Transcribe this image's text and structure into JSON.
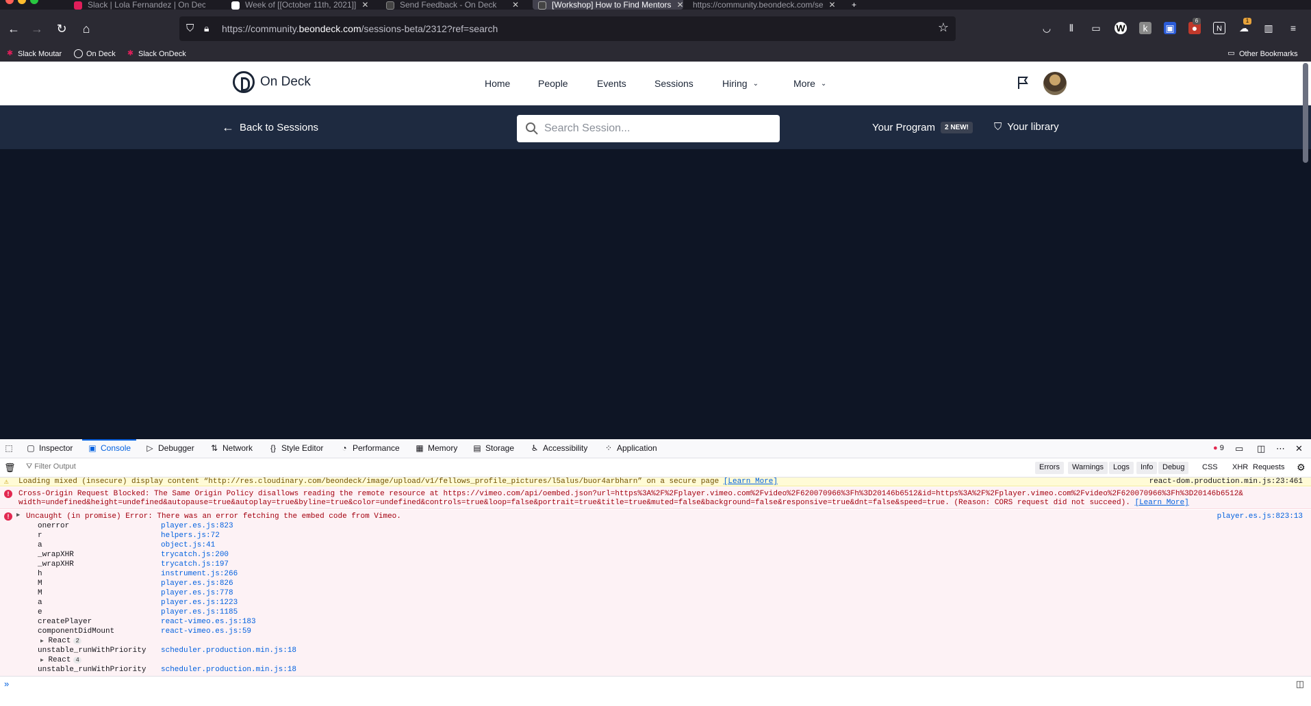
{
  "browser": {
    "tabs": [
      {
        "label": "Slack | Lola Fernandez | On Deck",
        "favicon_color": "#e01e5a"
      },
      {
        "label": "Week of [[October 11th, 2021]]",
        "favicon_color": "#ffffff"
      },
      {
        "label": "Send Feedback - On Deck",
        "favicon_color": "#444444"
      },
      {
        "label": "[Workshop] How to Find Mentors",
        "favicon_color": "#444444"
      },
      {
        "label": "https://community.beondeck.com/se",
        "favicon_color": "#444444"
      }
    ],
    "url_prefix": "https://community.",
    "url_domain": "beondeck.com",
    "url_path": "/sessions-beta/2312?ref=search",
    "bookmarks": [
      {
        "label": "Slack Moutar"
      },
      {
        "label": "On Deck"
      },
      {
        "label": "Slack OnDeck"
      }
    ],
    "other_bookmarks": "Other Bookmarks",
    "toolbar_badges": {
      "badge1": "6",
      "badge2": "1"
    }
  },
  "site": {
    "logo_text": "On Deck",
    "nav": {
      "home": "Home",
      "people": "People",
      "events": "Events",
      "sessions": "Sessions",
      "hiring": "Hiring",
      "more": "More"
    },
    "back_label": "Back to Sessions",
    "search_placeholder": "Search Session...",
    "program_label": "Your Program",
    "program_badge": "2 NEW!",
    "library_label": "Your library"
  },
  "devtools": {
    "tabs": {
      "inspector": "Inspector",
      "console": "Console",
      "debugger": "Debugger",
      "network": "Network",
      "style_editor": "Style Editor",
      "performance": "Performance",
      "memory": "Memory",
      "storage": "Storage",
      "accessibility": "Accessibility",
      "application": "Application"
    },
    "error_count": "9",
    "filter_placeholder": "Filter Output",
    "filters": {
      "errors": "Errors",
      "warnings": "Warnings",
      "logs": "Logs",
      "info": "Info",
      "debug": "Debug",
      "css": "CSS",
      "xhr": "XHR",
      "requests": "Requests"
    },
    "warning": {
      "text": "Loading mixed (insecure) display content “http://res.cloudinary.com/beondeck/image/upload/v1/fellows_profile_pictures/l5alus/buor4arbharn” on a secure page",
      "link": "[Learn More]",
      "source": "react-dom.production.min.js:23:461"
    },
    "cors_error": {
      "line1": "Cross-Origin Request Blocked: The Same Origin Policy disallows reading the remote resource at https://vimeo.com/api/oembed.json?url=https%3A%2F%2Fplayer.vimeo.com%2Fvideo%2F620070966%3Fh%3D20146b6512&id=https%3A%2F%2Fplayer.vimeo.com%2Fvideo%2F620070966%3Fh%3D20146b6512&",
      "line2": "width=undefined&height=undefined&autopause=true&autoplay=true&byline=true&color=undefined&controls=true&loop=false&portrait=true&title=true&muted=false&background=false&responsive=true&dnt=false&speed=true. (Reason: CORS request did not succeed).",
      "link": "[Learn More]"
    },
    "uncaught": {
      "text": "Uncaught (in promise) Error: There was an error fetching the embed code from Vimeo.",
      "source": "player.es.js:823:13"
    },
    "stack": [
      {
        "fn": "onerror",
        "loc": "player.es.js:823"
      },
      {
        "fn": "r",
        "loc": "helpers.js:72"
      },
      {
        "fn": "a",
        "loc": "object.js:41"
      },
      {
        "fn": "_wrapXHR",
        "loc": "trycatch.js:200"
      },
      {
        "fn": "_wrapXHR",
        "loc": "trycatch.js:197"
      },
      {
        "fn": "h",
        "loc": "instrument.js:266"
      },
      {
        "fn": "M",
        "loc": "player.es.js:826"
      },
      {
        "fn": "M",
        "loc": "player.es.js:778"
      },
      {
        "fn": "a",
        "loc": "player.es.js:1223"
      },
      {
        "fn": "e",
        "loc": "player.es.js:1185"
      },
      {
        "fn": "createPlayer",
        "loc": "react-vimeo.es.js:183"
      },
      {
        "fn": "componentDidMount",
        "loc": "react-vimeo.es.js:59"
      }
    ],
    "group1": {
      "label": "React",
      "count": "2"
    },
    "stack2": {
      "fn": "unstable_runWithPriority",
      "loc": "scheduler.production.min.js:18"
    },
    "group2": {
      "label": "React",
      "count": "4"
    },
    "stack3": {
      "fn": "unstable_runWithPriority",
      "loc": "scheduler.production.min.js:18"
    }
  }
}
